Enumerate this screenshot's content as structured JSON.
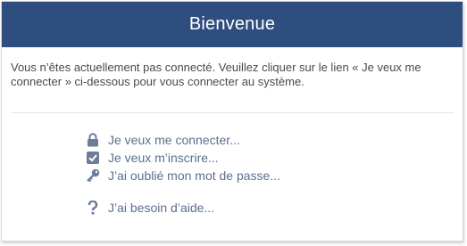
{
  "panel": {
    "title": "Bienvenue",
    "intro_text": "Vous n’êtes actuellement pas connecté. Veuillez cliquer sur le lien « Je veux me connecter » ci-dessous pour vous connecter au système."
  },
  "links": {
    "login": {
      "label": "Je veux me connecter...",
      "icon": "lock-icon"
    },
    "register": {
      "label": "Je veux m’inscrire...",
      "icon": "checkbox-icon"
    },
    "forgot_password": {
      "label": "J’ai oublié mon mot de passe...",
      "icon": "key-icon"
    },
    "help": {
      "label": "J’ai besoin d’aide...",
      "icon": "question-icon"
    }
  },
  "colors": {
    "header_bg": "#2f4e80",
    "link_text": "#5b6f8e",
    "icon": "#6b7d99"
  }
}
